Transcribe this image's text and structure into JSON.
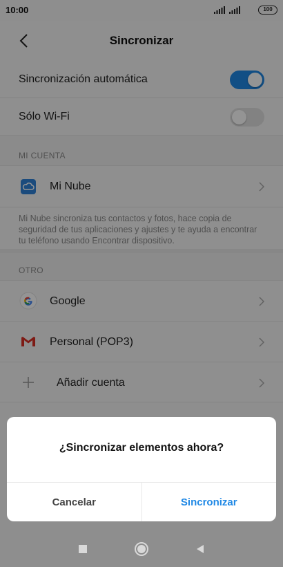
{
  "status_bar": {
    "time": "10:00",
    "battery": "100"
  },
  "header": {
    "title": "Sincronizar",
    "back_icon": "chevron-left-icon"
  },
  "settings": {
    "auto_sync": {
      "label": "Sincronización automática",
      "enabled": true
    },
    "wifi_only": {
      "label": "Sólo Wi-Fi",
      "enabled": false
    }
  },
  "mi_cuenta": {
    "section_title": "MI CUENTA",
    "mi_nube": {
      "label": "Mi Nube",
      "icon": "cloud-icon"
    },
    "description": "Mi Nube sincroniza tus contactos y fotos, hace copia de seguridad de tus aplicaciones y ajustes y te ayuda a encontrar tu teléfono usando Encontrar dispositivo."
  },
  "otro": {
    "section_title": "OTRO",
    "accounts": [
      {
        "label": "Google",
        "icon": "google-icon"
      },
      {
        "label": "Personal (POP3)",
        "icon": "gmail-icon"
      }
    ],
    "add_account": {
      "label": "Añadir cuenta",
      "icon": "plus-icon"
    }
  },
  "dialog": {
    "title": "¿Sincronizar elementos ahora?",
    "cancel_label": "Cancelar",
    "confirm_label": "Sincronizar"
  },
  "colors": {
    "accent": "#1f88e5",
    "text": "#222222",
    "muted": "#8a8a8a"
  }
}
